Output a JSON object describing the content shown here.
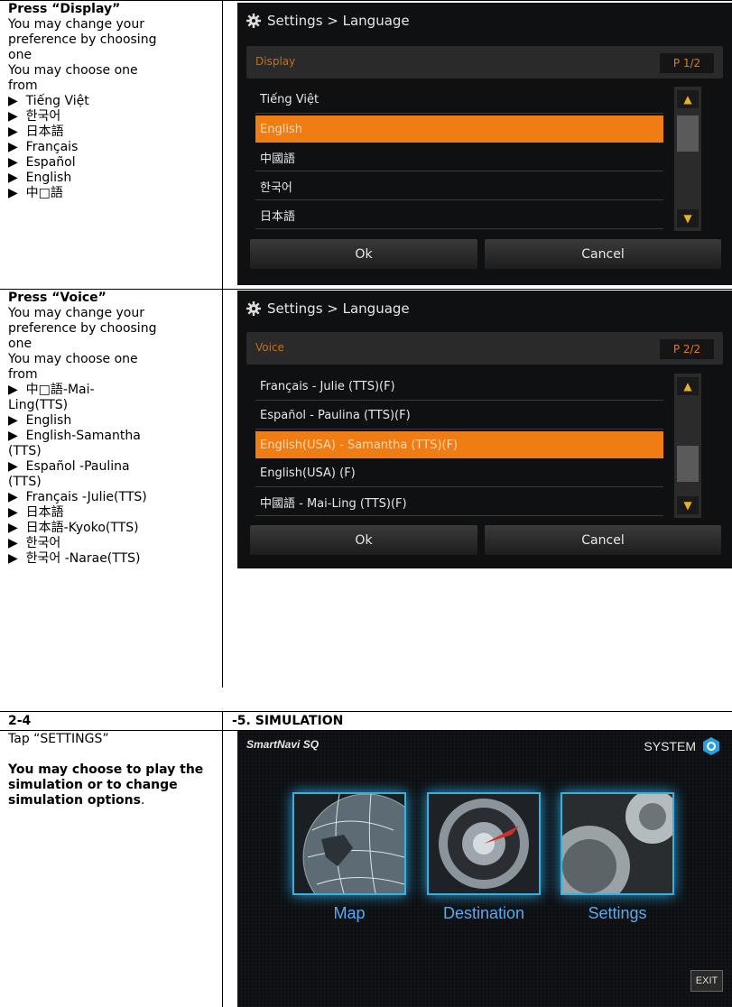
{
  "section1": {
    "left": {
      "heading": "Press “Display”",
      "lines": [
        "You may change your",
        "preference by choosing",
        "one",
        "You may choose one",
        "from"
      ],
      "items": [
        "▶  Tiếng Việt",
        "▶  한국어",
        "▶  日本語",
        "▶  Français",
        "▶  Español",
        "▶  English",
        "▶  中□語"
      ]
    },
    "screen": {
      "title": "Settings > Language",
      "sub_label": "Display",
      "page": "P 1/2",
      "options": [
        "Tiếng Việt",
        "English",
        "中國語",
        "한국어",
        "日本語"
      ],
      "selected_index": 1,
      "ok": "Ok",
      "cancel": "Cancel"
    }
  },
  "section2": {
    "left": {
      "heading": "Press “Voice”",
      "lines": [
        "You may change your",
        "preference by choosing",
        "one",
        "You may choose one",
        "from"
      ],
      "items": [
        "▶  中□語-Mai-",
        "Ling(TTS)",
        "▶  English",
        "▶  English-Samantha",
        "(TTS)",
        "▶  Español -Paulina",
        "(TTS)",
        "▶  Français -Julie(TTS)",
        "▶  日本語",
        "▶  日本語-Kyoko(TTS)",
        "▶  한국어",
        "▶  한국어 -Narae(TTS)"
      ]
    },
    "screen": {
      "title": "Settings > Language",
      "sub_label": "Voice",
      "page": "P 2/2",
      "options": [
        "Français - Julie (TTS)(F)",
        "Español - Paulina (TTS)(F)",
        "English(USA) - Samantha (TTS)(F)",
        "English(USA) (F)",
        "中國語 - Mai-Ling (TTS)(F)"
      ],
      "selected_index": 2,
      "ok": "Ok",
      "cancel": "Cancel"
    }
  },
  "section3": {
    "header_left": "2-4",
    "header_right": "-5. SIMULATION",
    "left": {
      "heading": "Tap “SETTINGS”",
      "bold_text": "You may choose to play the simulation or to change simulation options",
      "tail": "."
    },
    "screen": {
      "logo": "SmartNavi SQ",
      "system_label": "SYSTEM",
      "tiles": [
        "Map",
        "Destination",
        "Settings"
      ],
      "exit": "EXIT"
    }
  },
  "colors": {
    "accent_orange": "#f07d14",
    "navi_blue": "#5aa9f0",
    "tile_glow": "#3ab0e0"
  }
}
